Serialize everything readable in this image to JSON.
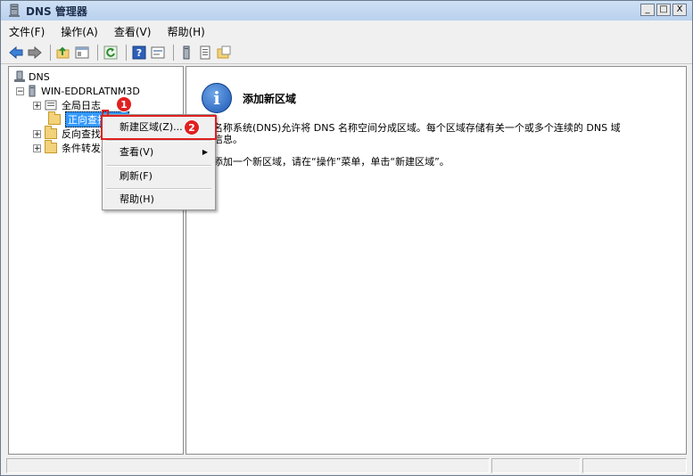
{
  "window": {
    "title": "DNS 管理器",
    "controls": [
      "_",
      "□",
      "X"
    ]
  },
  "menu": [
    "文件(F)",
    "操作(A)",
    "查看(V)",
    "帮助(H)"
  ],
  "toolbar": {
    "icons": [
      "back-arrow-icon",
      "forward-arrow-icon",
      "up-folder-icon",
      "show-hide-tree-icon",
      "refresh-icon",
      "help-icon",
      "properties-icon",
      "dns-server-icon",
      "list-icon",
      "new-zone-icon"
    ]
  },
  "tree": {
    "root": "DNS",
    "server": "WIN-EDDRLATNM3D",
    "items": [
      {
        "label": "全局日志"
      },
      {
        "label": "正向查找区域"
      },
      {
        "label": "反向查找区域"
      },
      {
        "label": "条件转发器"
      }
    ]
  },
  "content": {
    "heading": "添加新区域",
    "para1_line1": "名称系统(DNS)允许将 DNS 名称空间分成区域。每个区域存储有关一个或多个连续的 DNS 域",
    "para1_line2": "信息。",
    "para2": "添加一个新区域，请在“操作”菜单，单击“新建区域”。"
  },
  "context_menu": {
    "items": [
      {
        "label": "新建区域(Z)..."
      },
      {
        "label": "查看(V)",
        "submenu": true
      },
      {
        "label": "刷新(F)"
      },
      {
        "label": "帮助(H)"
      }
    ]
  },
  "badges": [
    "1",
    "2"
  ],
  "colors": {
    "highlight": "#3399ff",
    "annotation": "#e02020",
    "info_icon": "#1c58b5"
  }
}
